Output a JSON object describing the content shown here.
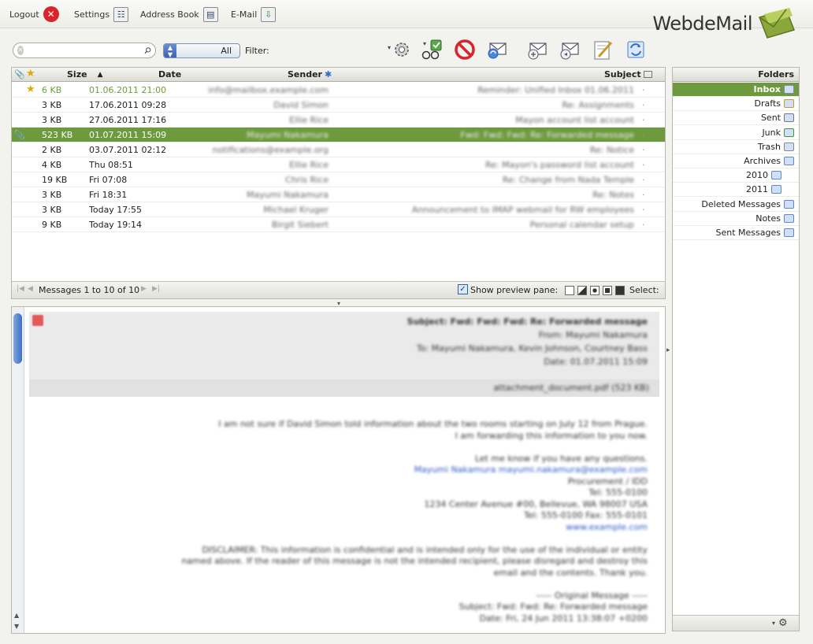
{
  "topnav": {
    "logout": "Logout",
    "settings": "Settings",
    "address_book": "Address Book",
    "email": "E-Mail"
  },
  "logo": {
    "text": "WebdeMail"
  },
  "search": {
    "value": ""
  },
  "filter": {
    "label": "Filter:",
    "value": "All"
  },
  "list": {
    "columns": {
      "subject": "Subject",
      "sender": "Sender",
      "date": "Date",
      "size": "Size"
    },
    "rows": [
      {
        "subject": "Reminder: Unified Inbox 01.06.2011",
        "sender": "info@mailbox.example.com",
        "date": "01.06.2011 21:00",
        "size": "6 KB",
        "flagged": true,
        "attachment": false,
        "selected": false,
        "unread": true
      },
      {
        "subject": "Re: Assignments",
        "sender": "David Simon",
        "date": "17.06.2011 09:28",
        "size": "3 KB",
        "flagged": false,
        "attachment": false,
        "selected": false,
        "unread": false
      },
      {
        "subject": "Mayon account list account",
        "sender": "Ellie Rice",
        "date": "27.06.2011 17:16",
        "size": "3 KB",
        "flagged": false,
        "attachment": false,
        "selected": false,
        "unread": false
      },
      {
        "subject": "Fwd: Fwd: Fwd: Re: Forwarded message",
        "sender": "Mayumi Nakamura",
        "date": "01.07.2011 15:09",
        "size": "523 KB",
        "flagged": false,
        "attachment": true,
        "selected": true,
        "unread": false
      },
      {
        "subject": "Re: Notice",
        "sender": "notifications@example.org",
        "date": "03.07.2011 02:12",
        "size": "2 KB",
        "flagged": false,
        "attachment": false,
        "selected": false,
        "unread": false
      },
      {
        "subject": "Re: Mayon's password list account",
        "sender": "Ellie Rice",
        "date": "Thu 08:51",
        "size": "4 KB",
        "flagged": false,
        "attachment": false,
        "selected": false,
        "unread": false
      },
      {
        "subject": "Re: Change from Nada Temple",
        "sender": "Chris Rice",
        "date": "Fri 07:08",
        "size": "19 KB",
        "flagged": false,
        "attachment": false,
        "selected": false,
        "unread": false
      },
      {
        "subject": "Re: Notes",
        "sender": "Mayumi Nakamura",
        "date": "Fri 18:31",
        "size": "3 KB",
        "flagged": false,
        "attachment": false,
        "selected": false,
        "unread": false
      },
      {
        "subject": "Announcement to IMAP webmail for RW employees",
        "sender": "Michael Kruger",
        "date": "Today 17:55",
        "size": "3 KB",
        "flagged": false,
        "attachment": false,
        "selected": false,
        "unread": false
      },
      {
        "subject": "Personal calendar setup",
        "sender": "Birgit Siebert",
        "date": "Today 19:14",
        "size": "9 KB",
        "flagged": false,
        "attachment": false,
        "selected": false,
        "unread": false
      }
    ],
    "footer": {
      "select_label": "Select:",
      "preview_label": "Show preview pane:",
      "count": "Messages 1 to 10 of 10"
    }
  },
  "preview": {
    "header_lines": [
      "Subject: Fwd: Fwd: Fwd: Re: Forwarded message",
      "From: Mayumi Nakamura",
      "To: Mayumi Nakamura, Kevin Johnson, Courtney Bass",
      "Date: 01.07.2011 15:09"
    ],
    "attachment_line": "attachment_document.pdf (523 KB)",
    "body_lines": [
      "I am not sure if David Simon told information about the two rooms starting on July 12 from Prague.",
      "I am forwarding this information to you now.",
      "",
      "Let me know if you have any questions.",
      "Mayumi Nakamura    mayumi.nakamura@example.com",
      "Procurement / IDD",
      "Tel: 555-0100",
      "1234 Center Avenue #00, Bellevue, WA 98007 USA",
      "Tel: 555-0100  Fax: 555-0101",
      "www.example.com",
      "",
      "DISCLAIMER: This information is confidential and is intended only for the use of the individual or entity",
      "named above. If the reader of this message is not the intended recipient, please disregard and destroy this",
      "email and the contents. Thank you.",
      "",
      "----- Original Message -----",
      "Subject: Fwd: Fwd: Re: Forwarded message",
      "Date: Fri, 24 Jun 2011 13:38:07 +0200"
    ]
  },
  "folders": {
    "title": "Folders",
    "items": [
      {
        "label": "Inbox",
        "icon": "inbox-icon",
        "indent": 0,
        "active": true
      },
      {
        "label": "Drafts",
        "icon": "pencil-icon",
        "indent": 0,
        "active": false
      },
      {
        "label": "Sent",
        "icon": "sent-icon",
        "indent": 0,
        "active": false
      },
      {
        "label": "Junk",
        "icon": "junk-icon",
        "indent": 0,
        "active": false
      },
      {
        "label": "Trash",
        "icon": "trash-icon",
        "indent": 0,
        "active": false
      },
      {
        "label": "Archives",
        "icon": "folder-icon",
        "indent": 0,
        "active": false
      },
      {
        "label": "2010",
        "icon": "folder-icon",
        "indent": 1,
        "active": false
      },
      {
        "label": "2011",
        "icon": "folder-icon",
        "indent": 1,
        "active": false
      },
      {
        "label": "Deleted Messages",
        "icon": "folder-icon",
        "indent": 0,
        "active": false
      },
      {
        "label": "Notes",
        "icon": "folder-icon",
        "indent": 0,
        "active": false
      },
      {
        "label": "Sent Messages",
        "icon": "folder-icon",
        "indent": 0,
        "active": false
      }
    ]
  },
  "colors": {
    "selected_row": "#6d9a3e",
    "unread_text": "#6aa03a",
    "logout_red": "#d8242a",
    "scroll_blue": "#3e6fc2"
  }
}
